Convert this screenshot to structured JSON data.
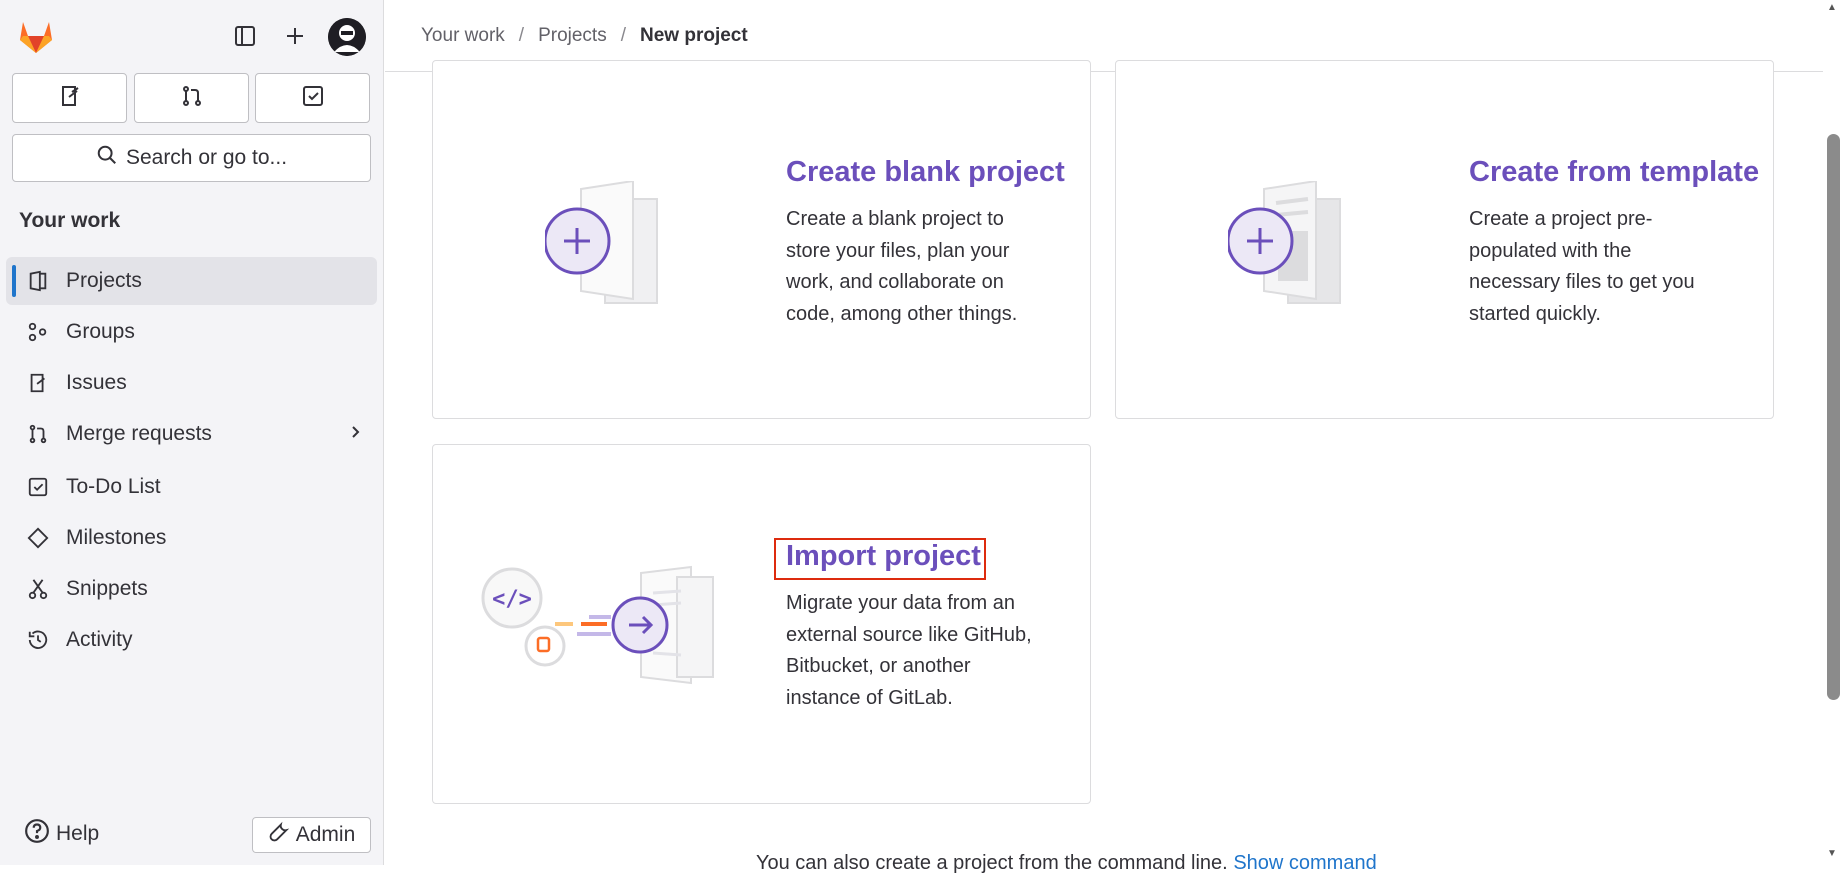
{
  "sidebar": {
    "search_label": "Search or go to...",
    "section_title": "Your work",
    "items": [
      {
        "label": "Projects",
        "icon": "project-icon",
        "active": true
      },
      {
        "label": "Groups",
        "icon": "group-icon"
      },
      {
        "label": "Issues",
        "icon": "issues-icon"
      },
      {
        "label": "Merge requests",
        "icon": "merge-request-icon",
        "has_children": true
      },
      {
        "label": "To-Do List",
        "icon": "todo-icon"
      },
      {
        "label": "Milestones",
        "icon": "milestone-icon"
      },
      {
        "label": "Snippets",
        "icon": "snippet-icon"
      },
      {
        "label": "Activity",
        "icon": "history-icon"
      }
    ],
    "help_label": "Help",
    "admin_label": "Admin"
  },
  "breadcrumb": {
    "items": [
      "Your work",
      "Projects",
      "New project"
    ]
  },
  "cards": {
    "blank": {
      "title": "Create blank project",
      "desc": [
        "Create a blank project to",
        "store your files, plan your",
        "work, and collaborate on",
        "code, among other things."
      ]
    },
    "template": {
      "title": "Create from template",
      "desc": [
        "Create a project pre-",
        "populated with the",
        "necessary files to get you",
        "started quickly."
      ]
    },
    "import": {
      "title": "Import project",
      "desc": [
        "Migrate your data from an",
        "external source like GitHub,",
        "Bitbucket, or another",
        "instance of GitLab."
      ]
    }
  },
  "footer": {
    "cli_text": "You can also create a project from the command line.",
    "cli_link": "Show command"
  },
  "colors": {
    "accent": "#6b4fbb",
    "active_indicator": "#1f75cb",
    "highlight_box": "#dd2b0e"
  }
}
